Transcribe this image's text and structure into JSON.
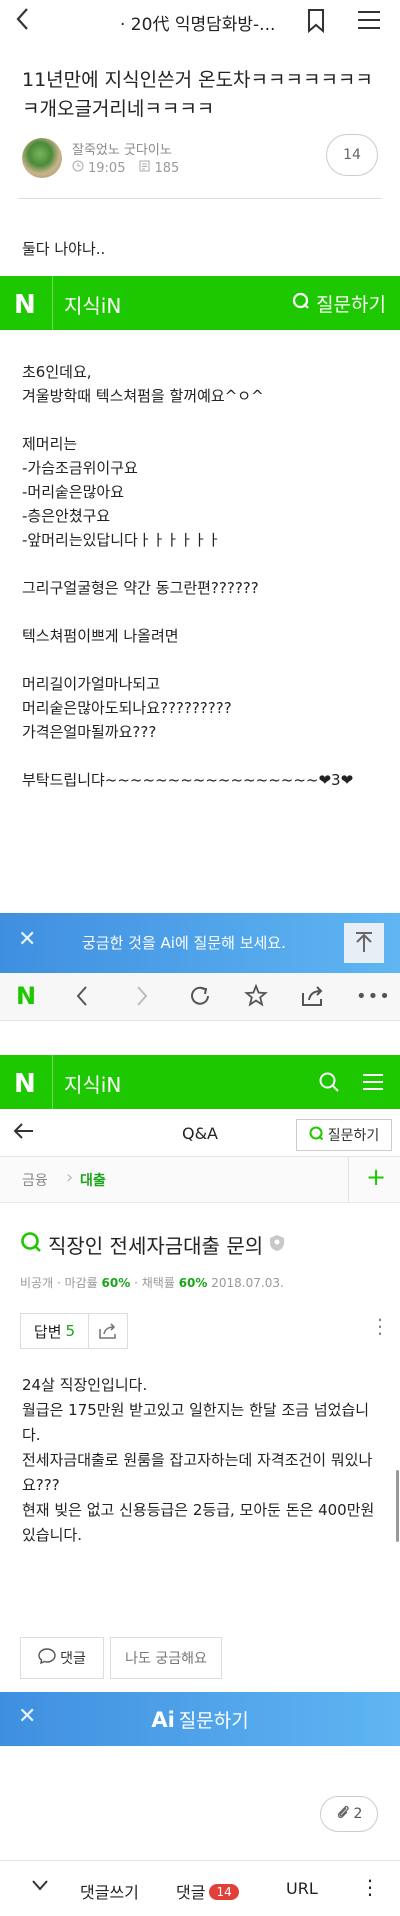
{
  "topbar": {
    "title": "· 20代 익명담화방-..."
  },
  "post": {
    "title": "11년만에 지식인쓴거 온도차ㅋㅋㅋㅋㅋㅋㅋㅋ개오글거리네ㅋㅋㅋㅋ",
    "author": "잘죽었노 굿다이노",
    "time": "19:05",
    "views": "185",
    "comment_count": "14",
    "intro": "둘다 나야나.."
  },
  "naver1": {
    "logo": "N",
    "brand": "지식iN",
    "ask": "질문하기"
  },
  "question1": {
    "body": "초6인데요,\n겨울방학때 텍스쳐펌을 할꺼예요^ㅇ^\n\n제머리는\n-가슴조금위이구요\n-머리숱은많아요\n-층은안쳤구요\n-앞머리는있답니다ㅏㅏㅏㅏㅏㅏ\n\n그리구얼굴형은 약간 동그란편??????\n\n텍스쳐펌이쁘게 나올려면\n\n머리길이가얼마나되고\n머리숱은많아도되나요?????????\n가격은얼마될까요???\n\n부탁드립니댜~~~~~~~~~~~~~~~~~❤3❤"
  },
  "ai_banner1": {
    "text": "궁금한 것을 Ai에 질문해 보세요."
  },
  "naver2": {
    "logo": "N",
    "brand": "지식iN"
  },
  "qa_header": {
    "title": "Q&A",
    "ask": "질문하기"
  },
  "category": {
    "parent": "금융",
    "child": "대출"
  },
  "question2": {
    "title": "직장인 전세자금대출 문의",
    "meta_private": "비공개",
    "meta_deadline_label": "마감률",
    "meta_deadline_value": "60%",
    "meta_adopt_label": "채택률",
    "meta_adopt_value": "60%",
    "meta_date": "2018.07.03.",
    "answers_label": "답변",
    "answers_count": "5",
    "body": "24살 직장인입니다.\n월급은 175만원 받고있고 일한지는 한달 조금 넘었습니다.\n전세자금대출로 원룸을 잡고자하는데 자격조건이 뭐있나요???\n현재 빚은 없고 신용등급은 2등급, 모아둔 돈은 400만원 있습니다.",
    "comment_btn": "댓글",
    "curious_btn": "나도 궁금해요"
  },
  "ai_banner2": {
    "ai": "Ai",
    "text": "질문하기"
  },
  "attach": {
    "count": "2"
  },
  "bottom_bar": {
    "write_comment": "댓글쓰기",
    "comments": "댓글",
    "comments_badge": "14",
    "url": "URL"
  }
}
